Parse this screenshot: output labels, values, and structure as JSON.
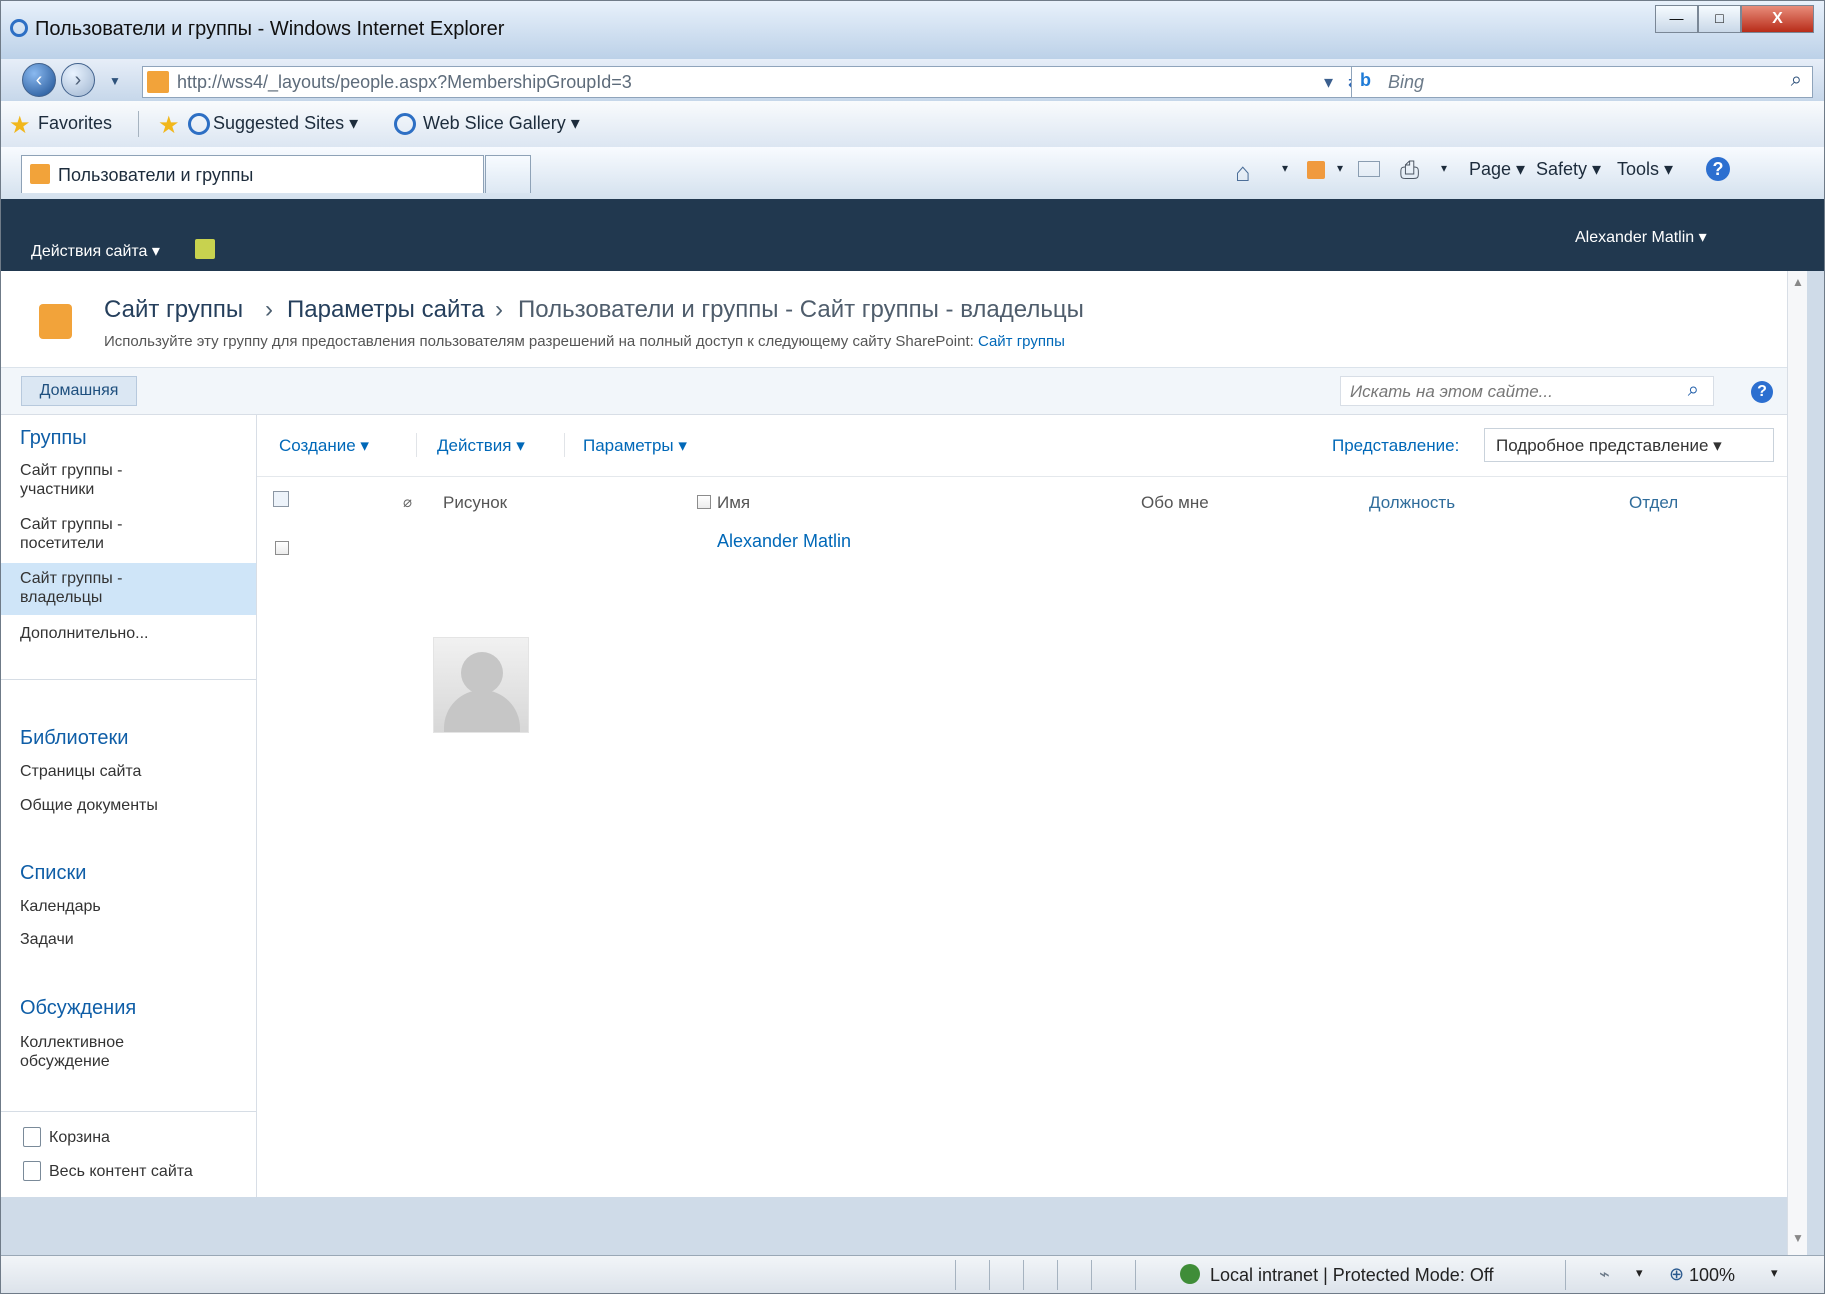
{
  "window": {
    "title": "Пользователи и группы - Windows Internet Explorer",
    "minimize_label": "—",
    "maximize_label": "□",
    "close_label": "X"
  },
  "address": {
    "url": "http://wss4/_layouts/people.aspx?MembershipGroupId=3",
    "search_placeholder": "Bing"
  },
  "favorites": {
    "favorites": "Favorites",
    "suggested_sites": "Suggested Sites ▾",
    "web_slice_gallery": "Web Slice Gallery ▾"
  },
  "tabs": {
    "active": "Пользователи и группы"
  },
  "commandbar": {
    "page": "Page ▾",
    "safety": "Safety ▾",
    "tools": "Tools ▾",
    "help": "?"
  },
  "sharepoint": {
    "site_actions": "Действия сайта ▾",
    "user": "Alexander Matlin ▾",
    "breadcrumb": {
      "part1": "Сайт группы",
      "sep1": "›",
      "part2": "Параметры сайта",
      "sep2": "›",
      "part3": "Пользователи и группы - Сайт группы - владельцы"
    },
    "description": "Используйте эту группу для предоставления пользователям разрешений на полный доступ к следующему сайту SharePoint:",
    "description_link": "Сайт группы",
    "home_tab": "Домашняя",
    "search_placeholder": "Искать на этом сайте...",
    "help": "?"
  },
  "left_nav": {
    "groups_heading": "Группы",
    "groups": [
      {
        "line1": "Сайт группы -",
        "line2": "участники"
      },
      {
        "line1": "Сайт группы -",
        "line2": "посетители"
      },
      {
        "line1": "Сайт группы -",
        "line2": "владельцы"
      }
    ],
    "more": "Дополнительно...",
    "libraries_heading": "Библиотеки",
    "libraries": [
      "Страницы сайта",
      "Общие документы"
    ],
    "lists_heading": "Списки",
    "lists": [
      "Календарь",
      "Задачи"
    ],
    "discussions_heading": "Обсуждения",
    "discussion_line1": "Коллективное",
    "discussion_line2": "обсуждение",
    "recycle": "Корзина",
    "all_content": "Весь контент сайта"
  },
  "toolbar": {
    "create": "Создание ▾",
    "actions": "Действия ▾",
    "settings": "Параметры ▾",
    "view_label": "Представление:",
    "view_value": "Подробное представление ▾"
  },
  "table": {
    "headers": {
      "picture": "Рисунок",
      "name": "Имя",
      "about": "Обо мне",
      "title": "Должность",
      "department": "Отдел"
    },
    "rows": [
      {
        "name": "Alexander Matlin",
        "about": "",
        "title": "",
        "department": ""
      }
    ]
  },
  "status": {
    "zone": "Local intranet | Protected Mode: Off",
    "zoom": "100%",
    "arrow": "▾"
  }
}
